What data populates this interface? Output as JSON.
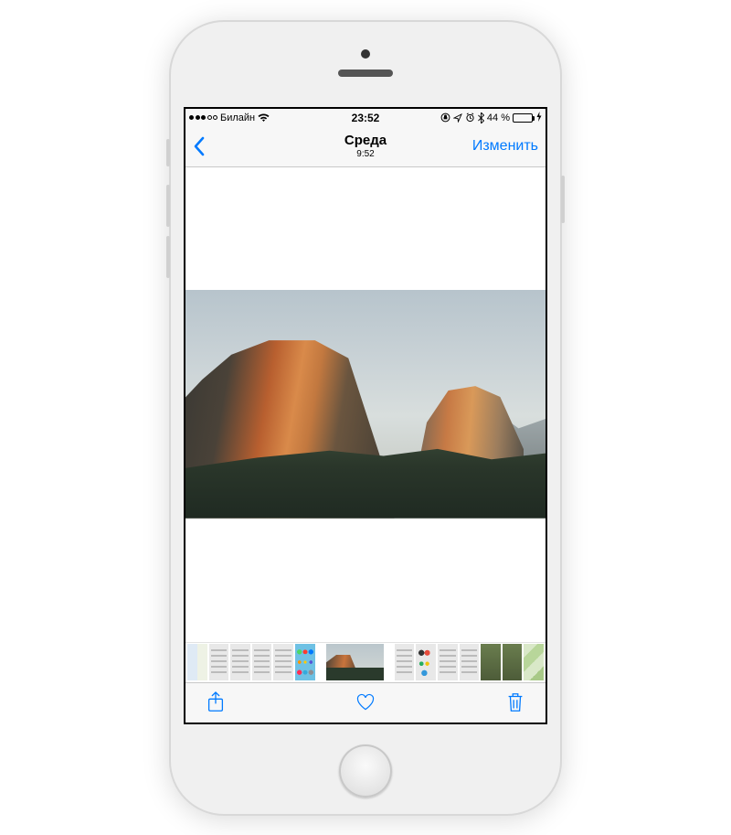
{
  "statusBar": {
    "carrier": "Билайн",
    "time": "23:52",
    "batteryPercent": "44 %",
    "signalFilled": 3,
    "signalTotal": 5
  },
  "navBar": {
    "title": "Среда",
    "subtitle": "9:52",
    "editLabel": "Изменить"
  },
  "toolbar": {
    "share": "share-icon",
    "favorite": "heart-icon",
    "delete": "trash-icon"
  },
  "thumbnails": {
    "count": 14,
    "selectedIndex": 6
  }
}
